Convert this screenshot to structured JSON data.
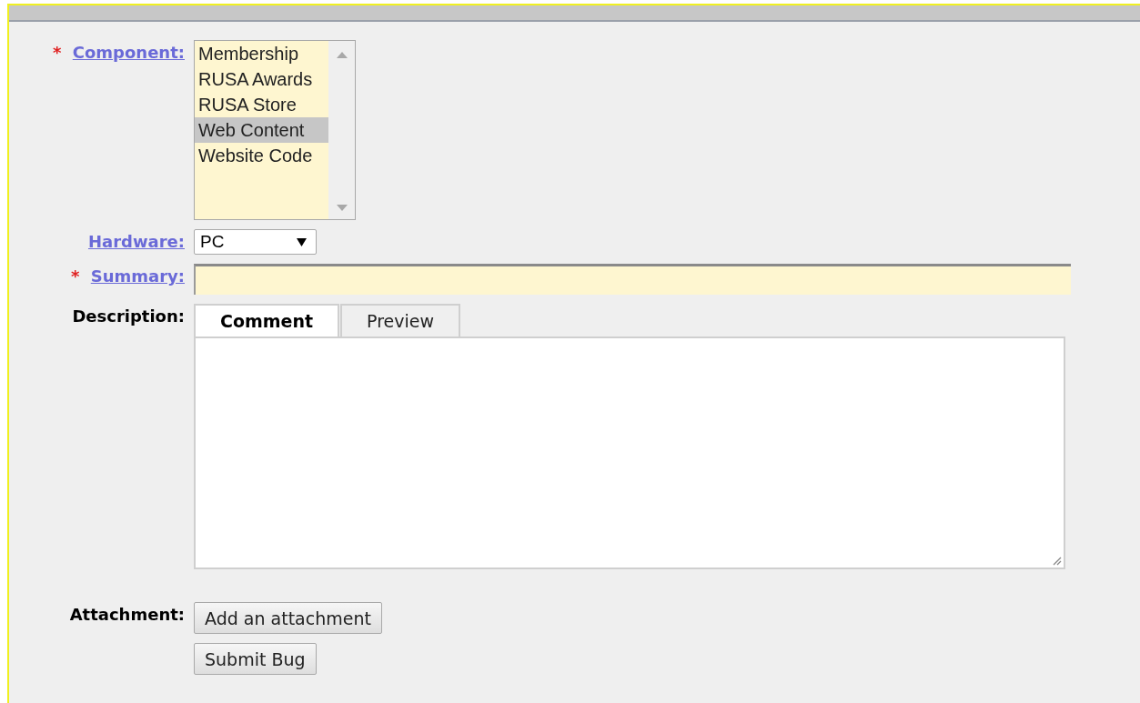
{
  "component": {
    "label": "Component:",
    "required_mark": "*",
    "link": true,
    "options": [
      {
        "label": "Membership",
        "selected": false
      },
      {
        "label": "RUSA Awards",
        "selected": false
      },
      {
        "label": "RUSA Store",
        "selected": false
      },
      {
        "label": "Web Content",
        "selected": true
      },
      {
        "label": "Website Code",
        "selected": false
      }
    ]
  },
  "hardware": {
    "label": "Hardware:",
    "link": true,
    "value": "PC"
  },
  "summary": {
    "label": "Summary:",
    "required_mark": "*",
    "link": true
  },
  "description": {
    "label": "Description:",
    "link": false,
    "tabs": [
      {
        "label": "Comment",
        "selected": true
      },
      {
        "label": "Preview",
        "selected": false
      }
    ]
  },
  "attachment": {
    "label": "Attachment:",
    "link": false,
    "button": "Add an attachment"
  },
  "submit_button": "Submit Bug"
}
